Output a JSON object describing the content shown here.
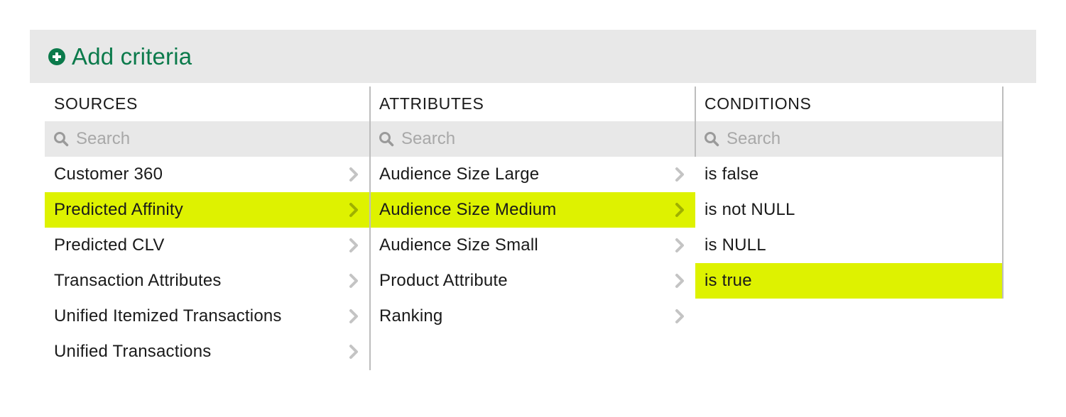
{
  "header": {
    "title": "Add criteria",
    "icon": "plus-circle-icon",
    "accent": "#0b7a4b"
  },
  "colors": {
    "selected": "#def200",
    "panel": "#e8e8e8"
  },
  "sources": {
    "heading": "SOURCES",
    "search_placeholder": "Search",
    "items": [
      {
        "label": "Customer 360",
        "selected": false
      },
      {
        "label": "Predicted Affinity",
        "selected": true
      },
      {
        "label": "Predicted CLV",
        "selected": false
      },
      {
        "label": "Transaction Attributes",
        "selected": false
      },
      {
        "label": "Unified Itemized Transactions",
        "selected": false
      },
      {
        "label": "Unified Transactions",
        "selected": false
      }
    ]
  },
  "attributes": {
    "heading": "ATTRIBUTES",
    "search_placeholder": "Search",
    "items": [
      {
        "label": "Audience Size Large",
        "selected": false
      },
      {
        "label": "Audience Size Medium",
        "selected": true
      },
      {
        "label": "Audience Size Small",
        "selected": false
      },
      {
        "label": "Product Attribute",
        "selected": false
      },
      {
        "label": "Ranking",
        "selected": false
      }
    ]
  },
  "conditions": {
    "heading": "CONDITIONS",
    "search_placeholder": "Search",
    "items": [
      {
        "label": "is false",
        "selected": false
      },
      {
        "label": "is not NULL",
        "selected": false
      },
      {
        "label": "is NULL",
        "selected": false
      },
      {
        "label": "is true",
        "selected": true
      }
    ]
  }
}
